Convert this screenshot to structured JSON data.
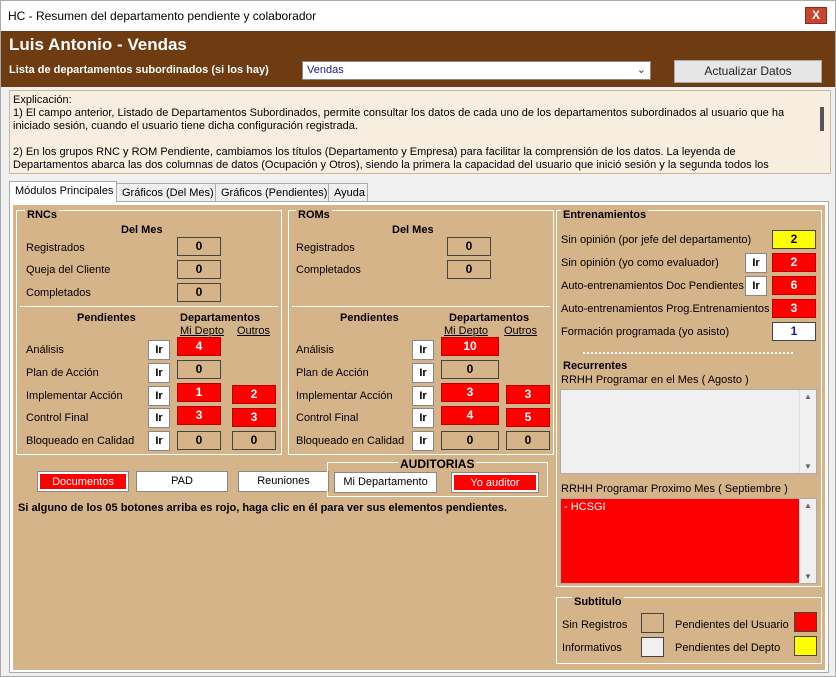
{
  "window": {
    "title": "HC - Resumen del departamento pendiente y colaborador",
    "close_label": "X"
  },
  "header": {
    "user_name": "Luis Antonio - Vendas",
    "dept_label": "Lista de departamentos subordinados (si los hay)",
    "dept_value": "Vendas",
    "update_button": "Actualizar Datos"
  },
  "explanation": {
    "lines": "Explicación:\n1) El campo anterior, Listado de Departamentos Subordinados, permite consultar los datos de cada uno de los departamentos subordinados al usuario que ha iniciado sesión, cuando el usuario tiene dicha configuración registrada.\n\n2) En los grupos RNC y ROM Pendiente, cambiamos los títulos (Departamento y Empresa) para facilitar la comprensión de los datos. La leyenda de Departamentos abarca las dos columnas de datos (Ocupación y Otros), siendo la primera la capacidad del usuario que inició sesión y la segunda todos los demás departamentos que"
  },
  "tabs": [
    "Módulos Principales",
    "Gráficos (Del Mes)",
    "Gráficos (Pendientes)",
    "Ayuda"
  ],
  "ir_label": "Ir",
  "rnc": {
    "title": "RNCs",
    "del_mes": "Del Mes",
    "month_rows": [
      {
        "label": "Registrados",
        "value": "0"
      },
      {
        "label": "Queja del Cliente",
        "value": "0"
      },
      {
        "label": "Completados",
        "value": "0"
      }
    ],
    "pend_title": "Pendientes",
    "dept_title": "Departamentos",
    "col_mine": "Mi Depto",
    "col_others": "Outros",
    "pending_rows": [
      {
        "label": "Análisis",
        "mine": "4",
        "others": null
      },
      {
        "label": "Plan de Acción",
        "mine": "0",
        "others": null
      },
      {
        "label": "Implementar Acción",
        "mine": "1",
        "others": "2"
      },
      {
        "label": "Control Final",
        "mine": "3",
        "others": "3"
      },
      {
        "label": "Bloqueado en Calidad",
        "mine": "0",
        "others": "0"
      }
    ]
  },
  "rom": {
    "title": "ROMs",
    "del_mes": "Del Mes",
    "month_rows": [
      {
        "label": "Registrados",
        "value": "0"
      },
      {
        "label": "Completados",
        "value": "0"
      }
    ],
    "pend_title": "Pendientes",
    "dept_title": "Departamentos",
    "col_mine": "Mi Depto",
    "col_others": "Outros",
    "pending_rows": [
      {
        "label": "Análisis",
        "mine": "10",
        "others": null
      },
      {
        "label": "Plan de Acción",
        "mine": "0",
        "others": null
      },
      {
        "label": "Implementar Acción",
        "mine": "3",
        "others": "3"
      },
      {
        "label": "Control Final",
        "mine": "4",
        "others": "5"
      },
      {
        "label": "Bloqueado en Calidad",
        "mine": "0",
        "others": "0"
      }
    ]
  },
  "buttons": {
    "documentos": "Documentos",
    "pad": "PAD",
    "reuniones": "Reuniones"
  },
  "auditorias": {
    "title": "AUDITORIAS",
    "mi_depto": "Mi Departamento",
    "yo_auditor": "Yo auditor"
  },
  "hint": "Si alguno de los 05 botones arriba es rojo, haga clic en él para ver sus elementos pendientes.",
  "entrenamientos": {
    "title": "Entrenamientos",
    "rows": [
      {
        "label": "Sin opinión (por jefe del departamento)",
        "value": "2",
        "color": "yellow",
        "ir": false
      },
      {
        "label": "Sin opinión (yo como evaluador)",
        "value": "2",
        "color": "red",
        "ir": true
      },
      {
        "label": "Auto-entrenamientos Doc Pendientes",
        "value": "6",
        "color": "red",
        "ir": true
      },
      {
        "label": "Auto-entrenamientos Prog.Entrenamientos",
        "value": "3",
        "color": "red",
        "ir": false
      },
      {
        "label": "Formación programada (yo asisto)",
        "value": "1",
        "color": "white",
        "ir": false
      }
    ],
    "recurrentes": "Recurrentes",
    "list1_label": "RRHH Programar en el Mes ( Agosto )",
    "list2_label": "RRHH Programar Proximo Mes ( Septiembre )",
    "list2_items": [
      "- HCSGI"
    ]
  },
  "legend": {
    "title": "Subtitulo",
    "sin_registros": "Sin Registros",
    "informativos": "Informativos",
    "pend_usuario": "Pendientes del Usuario",
    "pend_depto": "Pendientes del Depto",
    "colors": {
      "sin_registros": "#d6b48a",
      "informativos": "#f0f0f0",
      "pend_usuario": "#ff0000",
      "pend_depto": "#ffff00"
    }
  }
}
